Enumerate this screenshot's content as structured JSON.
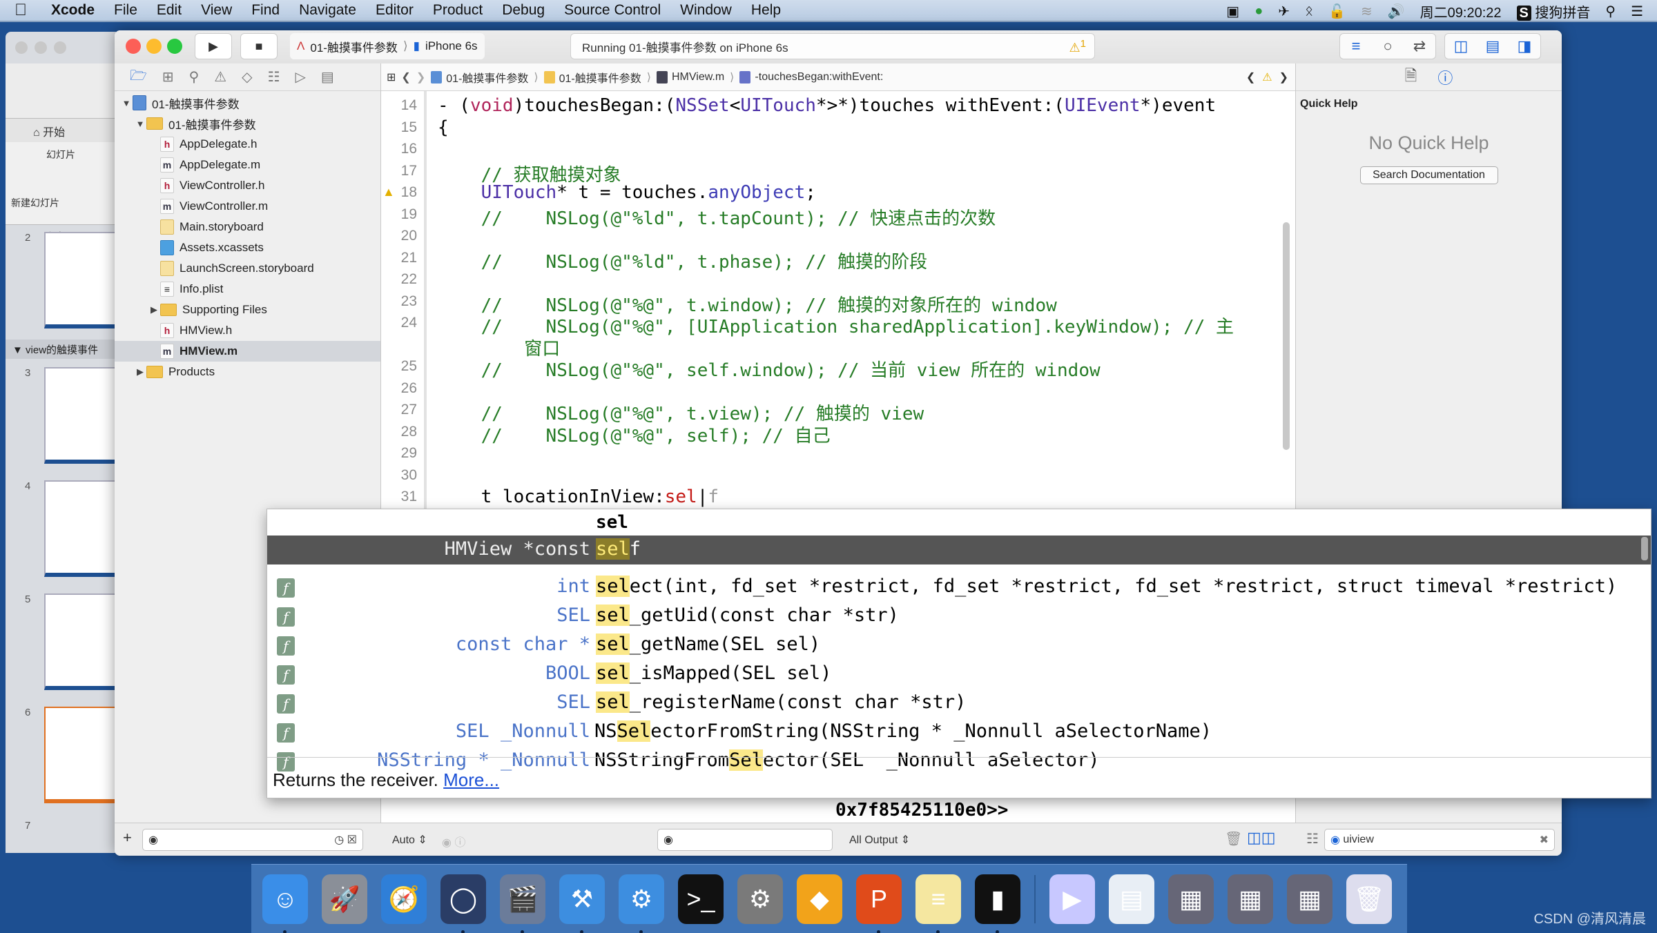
{
  "menubar": {
    "app": "Xcode",
    "items": [
      "File",
      "Edit",
      "View",
      "Find",
      "Navigate",
      "Editor",
      "Product",
      "Debug",
      "Source Control",
      "Window",
      "Help"
    ],
    "clock": "周二09:20:22",
    "input_method": "搜狗拼音",
    "status_icons": [
      "screen-record-icon",
      "green-play-icon",
      "airplane-icon",
      "bluetooth-icon",
      "lock-icon",
      "wifi-icon",
      "volume-icon"
    ]
  },
  "ppt": {
    "home_tab": "开始",
    "group_label": "幻灯片",
    "new_slide": "新建幻灯片",
    "slides_tab": "幻灯片",
    "slide_numbers": [
      "2",
      "3",
      "4",
      "5",
      "6",
      "7"
    ],
    "section_label": "view的触摸事件"
  },
  "toolbar": {
    "scheme_project": "01-触摸事件参数",
    "scheme_device": "iPhone 6s",
    "activity": "Running 01-触摸事件参数 on iPhone 6s",
    "warning_count": "1"
  },
  "navigator": {
    "items": [
      {
        "label": "01-触摸事件参数",
        "type": "proj",
        "indent": 0,
        "disclosure": "open"
      },
      {
        "label": "01-触摸事件参数",
        "type": "folder",
        "indent": 1,
        "disclosure": "open"
      },
      {
        "label": "AppDelegate.h",
        "type": "h",
        "indent": 2
      },
      {
        "label": "AppDelegate.m",
        "type": "m",
        "indent": 2
      },
      {
        "label": "ViewController.h",
        "type": "h",
        "indent": 2
      },
      {
        "label": "ViewController.m",
        "type": "m",
        "indent": 2
      },
      {
        "label": "Main.storyboard",
        "type": "sb",
        "indent": 2
      },
      {
        "label": "Assets.xcassets",
        "type": "assets",
        "indent": 2
      },
      {
        "label": "LaunchScreen.storyboard",
        "type": "sb",
        "indent": 2
      },
      {
        "label": "Info.plist",
        "type": "plist",
        "indent": 2
      },
      {
        "label": "Supporting Files",
        "type": "folder",
        "indent": 2,
        "disclosure": "closed"
      },
      {
        "label": "HMView.h",
        "type": "h",
        "indent": 2
      },
      {
        "label": "HMView.m",
        "type": "m",
        "indent": 2,
        "selected": true
      },
      {
        "label": "Products",
        "type": "folder",
        "indent": 1,
        "disclosure": "closed"
      }
    ]
  },
  "jumpbar": {
    "crumbs": [
      "01-触摸事件参数",
      "01-触摸事件参数",
      "HMView.m",
      "-touchesBegan:withEvent:"
    ]
  },
  "editor": {
    "lines": [
      {
        "n": "14",
        "html": "- (<span class='kw'>void</span>)touchesBegan:(<span class='ty'>NSSet</span>&lt;<span class='ty'>UITouch</span>*&gt;*)touches withEvent:(<span class='ty'>UIEvent</span>*)event"
      },
      {
        "n": "15",
        "html": "{"
      },
      {
        "n": "16",
        "html": ""
      },
      {
        "n": "17",
        "html": "    <span class='cmt'>// 获取触摸对象</span>"
      },
      {
        "n": "18",
        "html": "    <span class='ty'>UITouch</span>* t = touches.<span class='fn'>anyObject</span>;",
        "warn": true
      },
      {
        "n": "19",
        "html": "    <span class='cmt'>//    NSLog(@\"%ld\", t.tapCount); // 快速点击的次数</span>"
      },
      {
        "n": "20",
        "html": ""
      },
      {
        "n": "21",
        "html": "    <span class='cmt'>//    NSLog(@\"%ld\", t.phase); // 触摸的阶段</span>"
      },
      {
        "n": "22",
        "html": ""
      },
      {
        "n": "23",
        "html": "    <span class='cmt'>//    NSLog(@\"%@\", t.window); // 触摸的对象所在的 window</span>"
      },
      {
        "n": "24",
        "html": "    <span class='cmt'>//    NSLog(@\"%@\", [UIApplication sharedApplication].keyWindow); // 主</span>"
      },
      {
        "n": "",
        "html": "        <span class='cmt'>窗口</span>"
      },
      {
        "n": "25",
        "html": "    <span class='cmt'>//    NSLog(@\"%@\", self.window); // 当前 view 所在的 window</span>"
      },
      {
        "n": "26",
        "html": ""
      },
      {
        "n": "27",
        "html": "    <span class='cmt'>//    NSLog(@\"%@\", t.view); // 触摸的 view</span>"
      },
      {
        "n": "28",
        "html": "    <span class='cmt'>//    NSLog(@\"%@\", self); // 自己</span>"
      },
      {
        "n": "29",
        "html": ""
      },
      {
        "n": "30",
        "html": ""
      },
      {
        "n": "31",
        "html": "    t locationInView:<span class='red'>sel</span>|<span style='color:#999'>f</span>"
      }
    ]
  },
  "autocomplete": {
    "typed": "sel",
    "items": [
      {
        "ret": "HMView *const",
        "pre": "",
        "hl": "sel",
        "post": "f",
        "selected": true,
        "icon": false
      },
      {
        "ret": "int",
        "pre": "",
        "hl": "sel",
        "post": "ect(int, fd_set *restrict, fd_set *restrict, fd_set *restrict, struct timeval *restrict)",
        "icon": true
      },
      {
        "ret": "SEL",
        "pre": "",
        "hl": "sel",
        "post": "_getUid(const char *str)",
        "icon": true
      },
      {
        "ret": "const char *",
        "pre": "",
        "hl": "sel",
        "post": "_getName(SEL sel)",
        "icon": true
      },
      {
        "ret": "BOOL",
        "pre": "",
        "hl": "sel",
        "post": "_isMapped(SEL sel)",
        "icon": true
      },
      {
        "ret": "SEL",
        "pre": "",
        "hl": "sel",
        "post": "_registerName(const char *str)",
        "icon": true
      },
      {
        "ret": "SEL _Nonnull",
        "pre": "NS",
        "hl": "Sel",
        "post": "ectorFromString(NSString * _Nonnull aSelectorName)",
        "icon": true
      },
      {
        "ret": "NSString * _Nonnull",
        "pre": "NSStringFrom",
        "hl": "Sel",
        "post": "ector(SEL  _Nonnull aSelector)",
        "icon": true
      }
    ],
    "description": "Returns the receiver.",
    "more_link": "More..."
  },
  "debug": {
    "output": "0x7f85425110e0>>",
    "variables_mode": "Auto",
    "output_filter": "All Output"
  },
  "utilities": {
    "quick_help_title": "Quick Help",
    "no_quick_help": "No Quick Help",
    "search_docs": "Search Documentation",
    "library_filter": "uiview"
  },
  "dock": {
    "apps": [
      "Finder",
      "Launchpad",
      "Safari",
      "Mouse",
      "Photo Booth",
      "Xcode",
      "Instruments",
      "Terminal",
      "System Preferences",
      "Sketch",
      "Pages",
      "Notes",
      "Console",
      "Photo Theater",
      "Preview",
      "Screen 1",
      "Screen 2",
      "Screen 3",
      "Trash"
    ]
  },
  "watermark": "CSDN @清风清晨"
}
